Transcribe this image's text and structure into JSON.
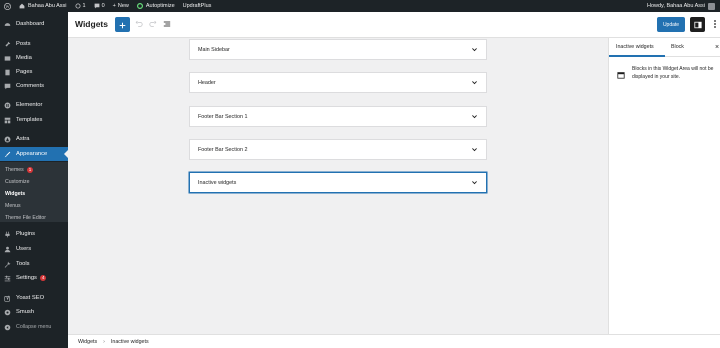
{
  "adminbar": {
    "site_name": "Bahaa Abu Assi",
    "updates_count": "1",
    "comments_count": "0",
    "new_label": "New",
    "autoptimize_label": "Autoptimize",
    "updraftplus_label": "UpdraftPlus",
    "howdy": "Howdy, Bahaa Abu Assi"
  },
  "sidebar": {
    "items": [
      {
        "label": "Dashboard",
        "icon": "dashboard-icon"
      },
      {
        "label": "Posts",
        "icon": "pin-icon"
      },
      {
        "label": "Media",
        "icon": "media-icon"
      },
      {
        "label": "Pages",
        "icon": "pages-icon"
      },
      {
        "label": "Comments",
        "icon": "comment-icon"
      },
      {
        "label": "Elementor",
        "icon": "elementor-icon"
      },
      {
        "label": "Templates",
        "icon": "templates-icon"
      },
      {
        "label": "Astra",
        "icon": "astra-icon"
      },
      {
        "label": "Appearance",
        "icon": "brush-icon"
      },
      {
        "label": "Plugins",
        "icon": "plugin-icon"
      },
      {
        "label": "Users",
        "icon": "users-icon"
      },
      {
        "label": "Tools",
        "icon": "wrench-icon"
      },
      {
        "label": "Settings",
        "icon": "settings-icon",
        "badge": "4"
      },
      {
        "label": "Yoast SEO",
        "icon": "yoast-icon"
      },
      {
        "label": "Smush",
        "icon": "smush-icon"
      },
      {
        "label": "Collapse menu",
        "icon": "collapse-icon"
      }
    ],
    "submenu": [
      {
        "label": "Themes",
        "badge": "1"
      },
      {
        "label": "Customize"
      },
      {
        "label": "Widgets"
      },
      {
        "label": "Menus"
      },
      {
        "label": "Theme File Editor"
      }
    ]
  },
  "header": {
    "title": "Widgets",
    "update_label": "Update"
  },
  "widget_areas": [
    {
      "label": "Main Sidebar"
    },
    {
      "label": "Header"
    },
    {
      "label": "Footer Bar Section 1"
    },
    {
      "label": "Footer Bar Section 2"
    },
    {
      "label": "Inactive widgets"
    }
  ],
  "inspector": {
    "tab_active": "Inactive widgets",
    "tab_block": "Block",
    "close": "×",
    "message": "Blocks in this Widget Area will not be displayed in your site."
  },
  "breadcrumb": {
    "root": "Widgets",
    "current": "Inactive widgets"
  },
  "colors": {
    "accent": "#2271b1",
    "admin_dark": "#1d2327",
    "badge": "#d63638"
  }
}
